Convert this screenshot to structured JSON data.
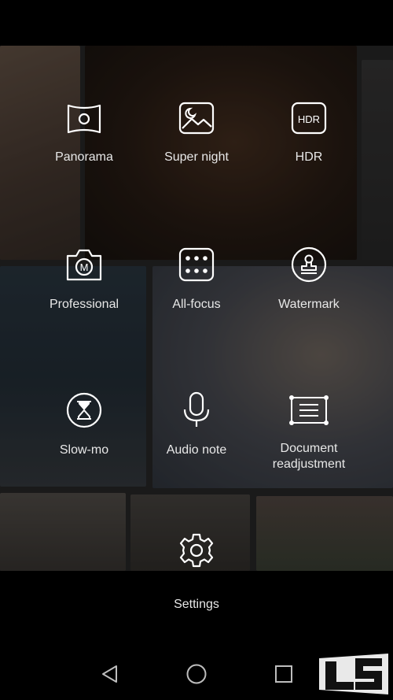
{
  "modes": [
    {
      "label": "Panorama",
      "icon": "panorama-icon"
    },
    {
      "label": "Super night",
      "icon": "super-night-icon"
    },
    {
      "label": "HDR",
      "icon": "hdr-icon",
      "icon_text": "HDR"
    },
    {
      "label": "Professional",
      "icon": "professional-camera-icon",
      "icon_text": "M"
    },
    {
      "label": "All-focus",
      "icon": "all-focus-icon"
    },
    {
      "label": "Watermark",
      "icon": "watermark-stamp-icon"
    },
    {
      "label": "Slow-mo",
      "icon": "hourglass-icon"
    },
    {
      "label": "Audio note",
      "icon": "microphone-icon"
    },
    {
      "label": "Document readjustment",
      "icon": "document-readjust-icon"
    }
  ],
  "settings": {
    "label": "Settings",
    "icon": "gear-icon"
  },
  "navbar": {
    "back": "back-icon",
    "home": "home-icon",
    "recents": "recents-icon"
  },
  "colors": {
    "text": "#e8e8e8",
    "icon_stroke": "#ffffff",
    "background": "#000000"
  }
}
